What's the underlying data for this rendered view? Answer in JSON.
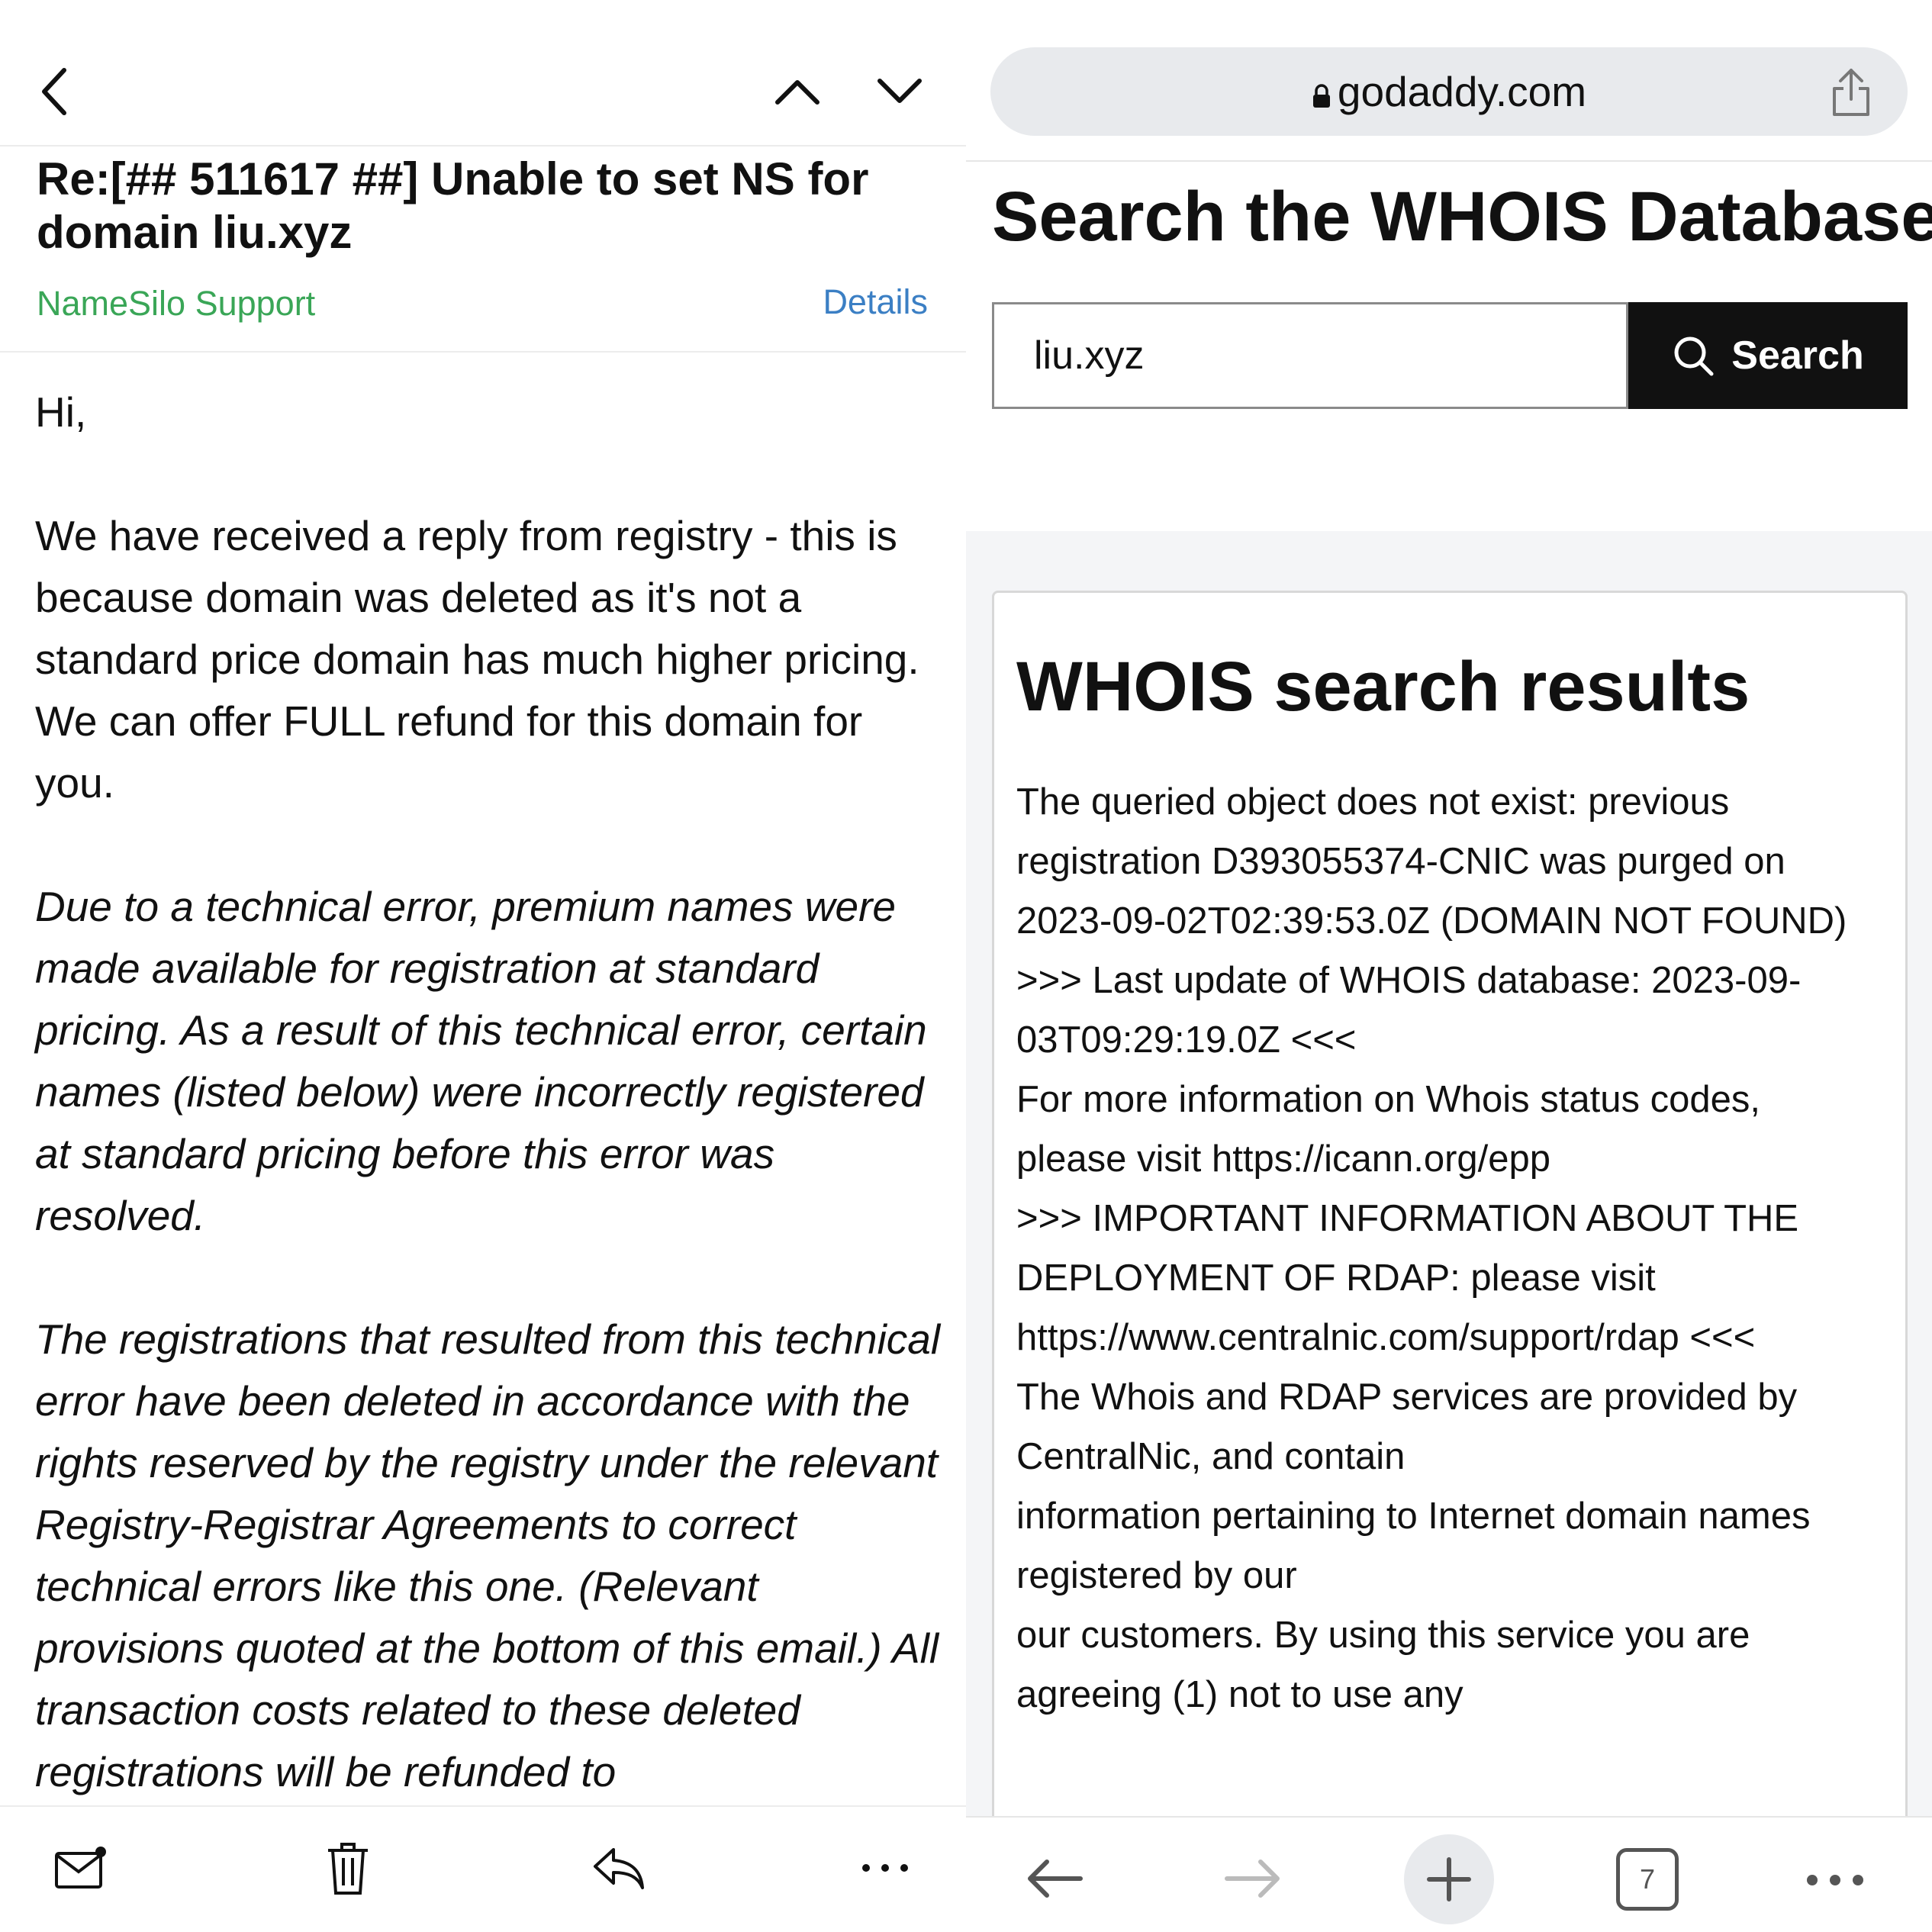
{
  "mail": {
    "subject": "Re:[## 511617 ##]  Unable to set NS for domain liu.xyz",
    "sender": "NameSilo Support",
    "details_label": "Details",
    "body": {
      "greeting": "Hi,",
      "p1": "We have received a reply from registry - this is because domain was deleted as it's not a standard price domain has much higher pricing. We can offer FULL refund for this domain for you.",
      "p2": "Due to a technical error, premium names were made available for registration at standard pricing. As a result of this technical error, certain names (listed below) were incorrectly registered at standard pricing before this error was resolved.",
      "p3": "The registrations that resulted from this technical error have been deleted in accordance with the rights reserved by the registry under the relevant Registry-Registrar Agreements to correct technical errors like this one. (Relevant provisions quoted at the bottom of this email.)  All transaction costs related to these deleted registrations will be refunded to"
    }
  },
  "browser": {
    "url": "godaddy.com",
    "page_title": "Search the WHOIS Database",
    "search_value": "liu.xyz",
    "search_button": "Search",
    "results_title": "WHOIS search results",
    "results": [
      "The queried object does not exist: previous registration D393055374-CNIC was purged on 2023-09-02T02:39:53.0Z (DOMAIN NOT FOUND)",
      ">>> Last update of WHOIS database: 2023-09-03T09:29:19.0Z <<<",
      "For more information on Whois status codes, please visit https://icann.org/epp",
      ">>> IMPORTANT INFORMATION ABOUT THE DEPLOYMENT OF RDAP: please visit https://www.centralnic.com/support/rdap <<<",
      "The Whois and RDAP services are provided by CentralNic, and contain",
      "information pertaining to Internet domain names registered by our",
      "our customers. By using this service you are agreeing (1) not to use any"
    ],
    "tab_count": "7"
  }
}
